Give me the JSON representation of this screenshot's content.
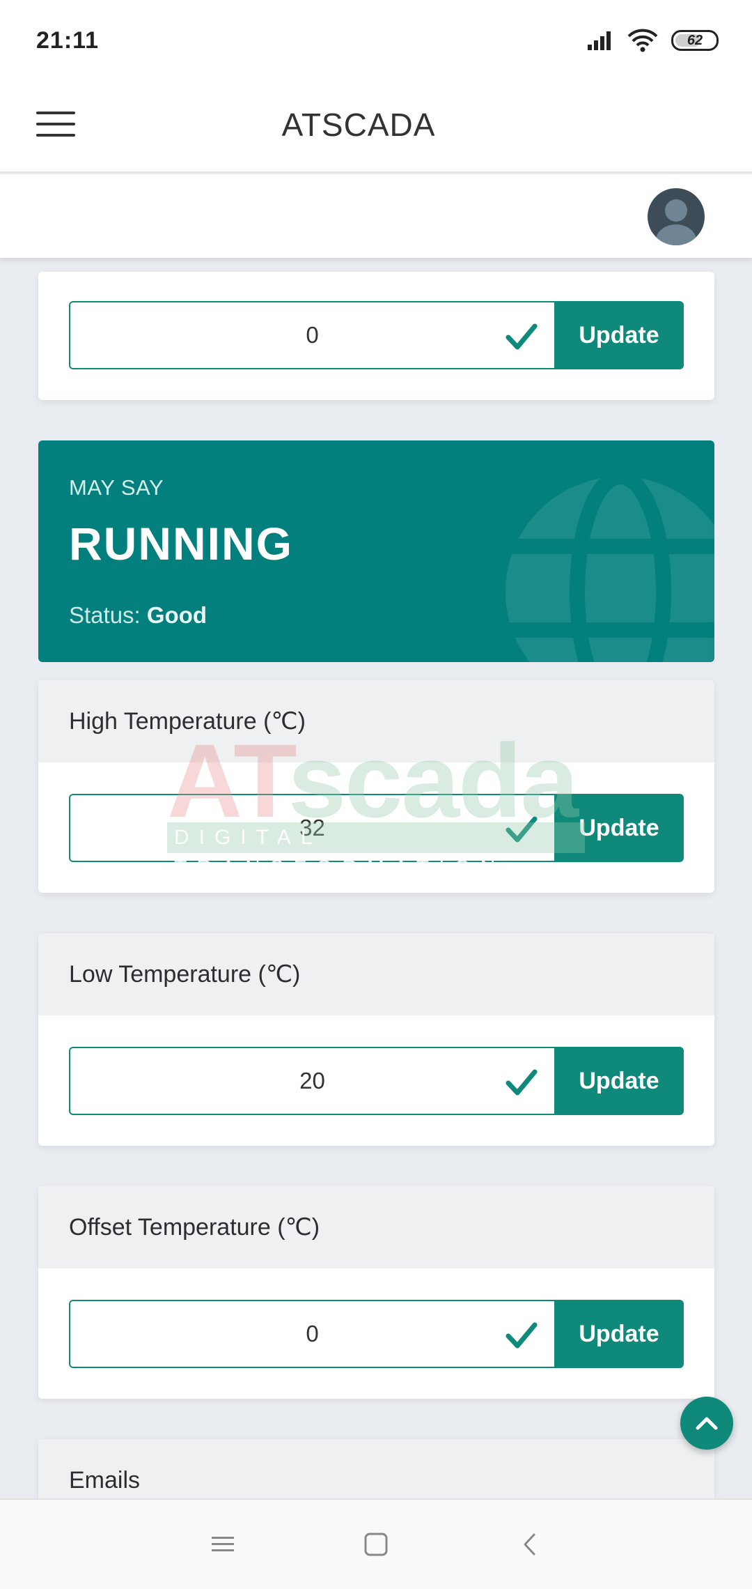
{
  "status_bar": {
    "time": "21:11",
    "battery_level": "62"
  },
  "header": {
    "app_title": "ATSCADA"
  },
  "first_card": {
    "value": "0",
    "button_label": "Update"
  },
  "status_card": {
    "device": "MAY SAY",
    "state": "RUNNING",
    "status_prefix": "Status: ",
    "status_value": "Good"
  },
  "settings": [
    {
      "title": "High Temperature (℃)",
      "value": "32",
      "button_label": "Update"
    },
    {
      "title": "Low Temperature (℃)",
      "value": "20",
      "button_label": "Update"
    },
    {
      "title": "Offset Temperature (℃)",
      "value": "0",
      "button_label": "Update"
    }
  ],
  "emails_card": {
    "title": "Emails"
  },
  "watermark": {
    "logo_at": "AT",
    "logo_scada": "scada",
    "tagline": "DIGITAL TRANSFORMATION"
  },
  "colors": {
    "accent": "#0f8a7a",
    "status_card_bg": "#03807d",
    "background": "#e9edf1"
  }
}
